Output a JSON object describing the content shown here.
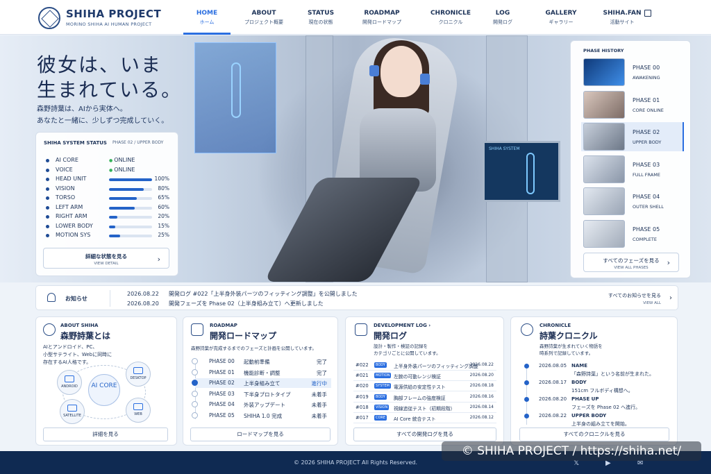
{
  "brand": {
    "title": "SHIHA PROJECT",
    "subtitle": "MORINO SHIHA AI HUMAN PROJECT"
  },
  "nav": [
    {
      "en": "HOME",
      "jp": "ホーム"
    },
    {
      "en": "ABOUT",
      "jp": "プロジェクト概要"
    },
    {
      "en": "STATUS",
      "jp": "現在の状態"
    },
    {
      "en": "ROADMAP",
      "jp": "開発ロードマップ"
    },
    {
      "en": "CHRONICLE",
      "jp": "クロニクル"
    },
    {
      "en": "LOG",
      "jp": "開発ログ"
    },
    {
      "en": "GALLERY",
      "jp": "ギャラリー"
    },
    {
      "en": "SHIHA.FAN",
      "jp": "活動サイト"
    }
  ],
  "hero": {
    "title1": "彼女は、いま",
    "title2": "生まれている。",
    "lead1": "森野詩葉は、AIから実体へ。",
    "lead2": "あなたと一緒に、少しずつ完成していく。",
    "screen_text": "SHIHA SYSTEM"
  },
  "status": {
    "heading": "SHIHA SYSTEM STATUS",
    "phase": "PHASE 02 / UPPER BODY",
    "rows": [
      {
        "name": "AI CORE",
        "state": "ONLINE"
      },
      {
        "name": "VOICE",
        "state": "ONLINE"
      },
      {
        "name": "HEAD UNIT",
        "pct": "100%",
        "value": 100
      },
      {
        "name": "VISION",
        "pct": "80%",
        "value": 80
      },
      {
        "name": "TORSO",
        "pct": "65%",
        "value": 65
      },
      {
        "name": "LEFT ARM",
        "pct": "60%",
        "value": 60
      },
      {
        "name": "RIGHT ARM",
        "pct": "20%",
        "value": 20
      },
      {
        "name": "LOWER BODY",
        "pct": "15%",
        "value": 15
      },
      {
        "name": "MOTION SYS",
        "pct": "25%",
        "value": 25
      }
    ],
    "btn_jp": "詳細な状態を見る",
    "btn_en": "VIEW DETAIL"
  },
  "phase_history": {
    "heading": "PHASE HISTORY",
    "items": [
      {
        "name": "PHASE 00",
        "desc": "AWAKENING"
      },
      {
        "name": "PHASE 01",
        "desc": "CORE ONLINE"
      },
      {
        "name": "PHASE 02",
        "desc": "UPPER BODY"
      },
      {
        "name": "PHASE 03",
        "desc": "FULL FRAME"
      },
      {
        "name": "PHASE 04",
        "desc": "OUTER SHELL"
      },
      {
        "name": "PHASE 05",
        "desc": "COMPLETE"
      }
    ],
    "btn_jp": "すべてのフェーズを見る",
    "btn_en": "VIEW ALL PHASES"
  },
  "news": {
    "label": "お知らせ",
    "items": [
      {
        "date": "2026.08.22",
        "text": "開発ログ #022「上半身外装パーツのフィッティング調整」を公開しました"
      },
      {
        "date": "2026.08.20",
        "text": "開発フェーズを Phase 02（上半身組み立て）へ更新しました"
      }
    ],
    "all_jp": "すべてのお知らせを見る",
    "all_en": "VIEW ALL"
  },
  "about": {
    "en": "ABOUT SHIHA",
    "jp": "森野詩葉とは",
    "desc1": "AIとアンドロイド、PC、",
    "desc2": "小型サテライト、Webに同時に",
    "desc3": "存在するAI人格です。",
    "core": "AI CORE",
    "nodes": [
      "ANDROID",
      "DESKTOP",
      "SATELLITE",
      "WEB"
    ],
    "btn": "詳細を見る"
  },
  "roadmap": {
    "en": "ROADMAP",
    "jp": "開発ロードマップ",
    "desc": "森野詩葉が完成するまでのフェーズと計画を公開しています。",
    "rows": [
      {
        "phase": "PHASE 00",
        "title": "起動前準備",
        "state": "完了"
      },
      {
        "phase": "PHASE 01",
        "title": "機能診断・調整",
        "state": "完了"
      },
      {
        "phase": "PHASE 02",
        "title": "上半身組み立て",
        "state": "進行中"
      },
      {
        "phase": "PHASE 03",
        "title": "下半身プロトタイプ",
        "state": "未着手"
      },
      {
        "phase": "PHASE 04",
        "title": "外装アップデート",
        "state": "未着手"
      },
      {
        "phase": "PHASE 05",
        "title": "SHIHA 1.0 完成",
        "state": "未着手"
      }
    ],
    "btn": "ロードマップを見る"
  },
  "devlog": {
    "en": "DEVELOPMENT LOG ›",
    "jp": "開発ログ",
    "desc1": "設計・製作・検証の記録を",
    "desc2": "カテゴリごとに公開しています。",
    "rows": [
      {
        "no": "#022",
        "tag": "BODY",
        "title": "上半身外装パーツのフィッティング調整",
        "date": "2026.08.22"
      },
      {
        "no": "#021",
        "tag": "MOTION",
        "title": "左腕の可動レンジ検証",
        "date": "2026.08.20"
      },
      {
        "no": "#020",
        "tag": "SYSTEM",
        "title": "電源供給の安定性テスト",
        "date": "2026.08.18"
      },
      {
        "no": "#019",
        "tag": "BODY",
        "title": "胸部フレームの強度検証",
        "date": "2026.08.16"
      },
      {
        "no": "#018",
        "tag": "VISION",
        "title": "視線追従テスト（初期段階）",
        "date": "2026.08.14"
      },
      {
        "no": "#017",
        "tag": "CORE",
        "title": "AI Core 統合テスト",
        "date": "2026.08.12"
      }
    ],
    "btn": "すべての開発ログを見る"
  },
  "chronicle": {
    "en": "CHRONICLE",
    "jp": "詩葉クロニクル",
    "desc1": "森野詩葉が生まれていく物語を",
    "desc2": "時系列で記録しています。",
    "rows": [
      {
        "date": "2026.08.05",
        "key": "NAME",
        "val": "「森野詩葉」という名前が生まれた。"
      },
      {
        "date": "2026.08.17",
        "key": "BODY",
        "val": "151cm フルボディ構想へ。"
      },
      {
        "date": "2026.08.20",
        "key": "PHASE UP",
        "val": "フェーズを Phase 02 へ進行。"
      },
      {
        "date": "2026.08.22",
        "key": "UPPER BODY",
        "val": "上半身の組み立てを開始。"
      }
    ],
    "btn": "すべてのクロニクルを見る"
  },
  "footer": {
    "copy": "© 2026 SHIHA PROJECT All Rights Reserved."
  },
  "watermark": "© SHIHA PROJECT / https://shiha.net/",
  "colors": {
    "accent": "#2a6ee0",
    "navy": "#0f2a52"
  }
}
